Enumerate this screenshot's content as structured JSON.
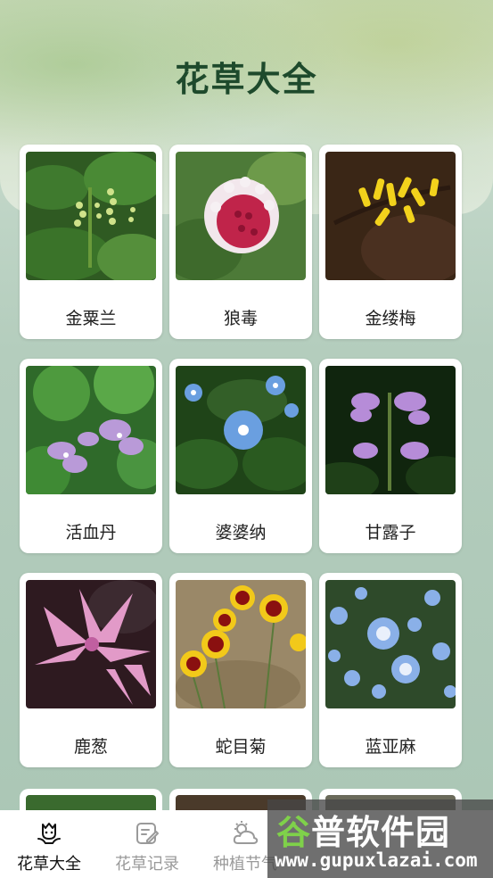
{
  "page": {
    "title": "花草大全"
  },
  "plants": [
    {
      "name": "金粟兰",
      "photo_icon": "chloranthus-photo"
    },
    {
      "name": "狼毒",
      "photo_icon": "stellera-photo"
    },
    {
      "name": "金缕梅",
      "photo_icon": "witch-hazel-photo"
    },
    {
      "name": "活血丹",
      "photo_icon": "glechoma-photo"
    },
    {
      "name": "婆婆纳",
      "photo_icon": "veronica-photo"
    },
    {
      "name": "甘露子",
      "photo_icon": "stachys-photo"
    },
    {
      "name": "鹿葱",
      "photo_icon": "lycoris-photo"
    },
    {
      "name": "蛇目菊",
      "photo_icon": "coreopsis-photo"
    },
    {
      "name": "蓝亚麻",
      "photo_icon": "blue-flax-photo"
    }
  ],
  "tabbar": {
    "tabs": [
      {
        "label": "花草大全",
        "icon": "flower-icon",
        "active": true
      },
      {
        "label": "花草记录",
        "icon": "note-edit-icon",
        "active": false
      },
      {
        "label": "种植节气",
        "icon": "weather-cloud-icon",
        "active": false
      }
    ]
  },
  "watermark": {
    "first_char": "谷",
    "rest": "普软件园",
    "url": "www.gupuxlazai.com"
  },
  "colors": {
    "title": "#1e4a2c",
    "card_background": "#ffffff",
    "tab_active": "#111111",
    "tab_inactive": "#9a9a9a"
  }
}
